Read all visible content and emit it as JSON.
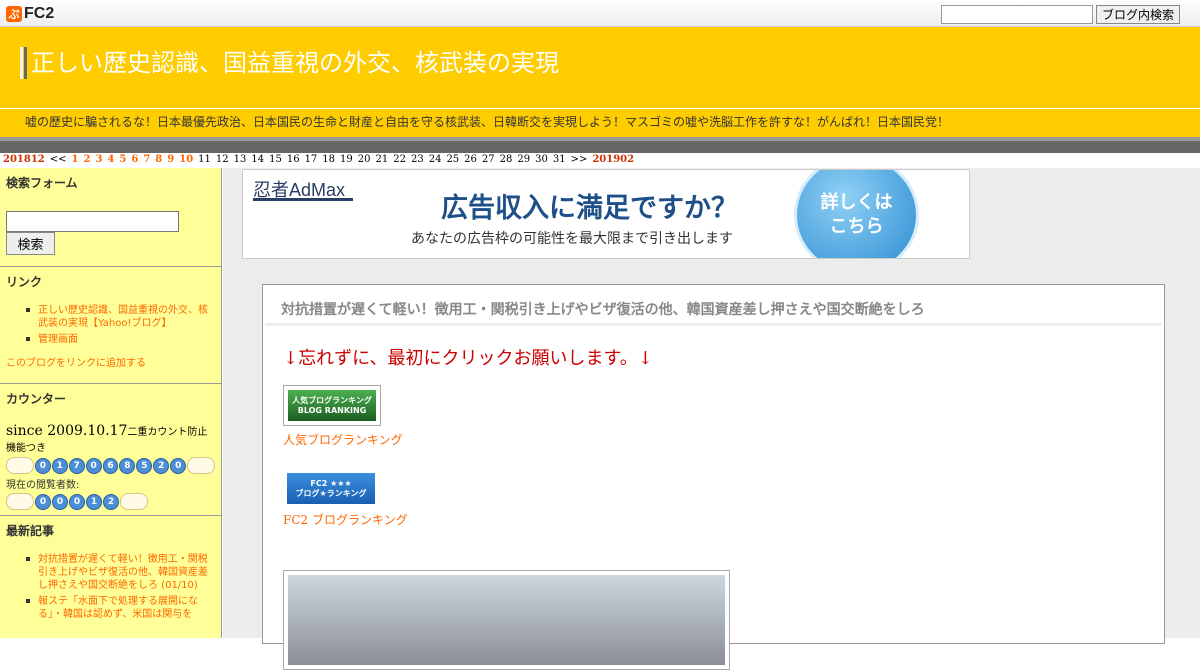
{
  "topbar": {
    "logo_text": "FC2",
    "search_placeholder": "",
    "search_button": "ブログ内検索"
  },
  "header": {
    "title": "正しい歴史認識、国益重視の外交、核武装の実現",
    "description": "嘘の歴史に騙されるな！日本最優先政治、日本国民の生命と財産と自由を守る核武装、日韓断交を実現しよう！マスゴミの嘘や洗脳工作を許すな！がんばれ！日本国民党！"
  },
  "calendar": {
    "prev": "201812",
    "prev_arrow": "<<",
    "days_linked": [
      "1",
      "2",
      "3",
      "4",
      "5",
      "6",
      "7",
      "8",
      "9",
      "10"
    ],
    "days_plain": [
      "11",
      "12",
      "13",
      "14",
      "15",
      "16",
      "17",
      "18",
      "19",
      "20",
      "21",
      "22",
      "23",
      "24",
      "25",
      "26",
      "27",
      "28",
      "29",
      "30",
      "31"
    ],
    "next_arrow": ">>",
    "next": "201902"
  },
  "sidebar": {
    "search": {
      "title": "検索フォーム",
      "button": "検索"
    },
    "links": {
      "title": "リンク",
      "items": [
        "正しい歴史認識、国益重視の外交、核武装の実現【Yahoo!ブログ】",
        "管理画面"
      ],
      "add_link": "このブログをリンクに追加する"
    },
    "counter": {
      "title": "カウンター",
      "since": "since 2009.10.17",
      "since_note": "二重カウント防止機能つき",
      "digits": [
        "0",
        "1",
        "7",
        "0",
        "6",
        "8",
        "5",
        "2",
        "0"
      ],
      "current_label": "現在の閲覧者数:",
      "current_digits": [
        "0",
        "0",
        "0",
        "1",
        "2"
      ]
    },
    "recent": {
      "title": "最新記事",
      "items": [
        "対抗措置が遅くて軽い！徴用工・関税引き上げやビザ復活の他、韓国資産差し押さえや国交断絶をしろ (01/10)",
        "報ステ「水面下で処理する展開になる」・韓国は認めず、米国は関与を"
      ]
    }
  },
  "ad": {
    "brand": "忍者AdMax",
    "headline": "広告収入に満足ですか？",
    "sub": "あなたの広告枠の可能性を最大限まで引き出します",
    "circle_text": "詳しくは\nこちら"
  },
  "post": {
    "title": "対抗措置が遅くて軽い！徴用工・関税引き上げやビザ復活の他、韓国資産差し押さえや国交断絶をしろ",
    "click_please": "↓忘れずに、最初にクリックお願いします。↓",
    "banner1_text": "人気ブログランキング\nBLOG RANKING",
    "banner1_link": "人気ブログランキング",
    "banner2_text": "FC2 ★★★\nブログ★ランキング",
    "banner2_link": "FC2 ブログランキング"
  },
  "colors": {
    "header_bg": "#ffcc00",
    "sidebar_bg": "#ffff99",
    "link": "#ff6600",
    "click_red": "#cc0000"
  }
}
